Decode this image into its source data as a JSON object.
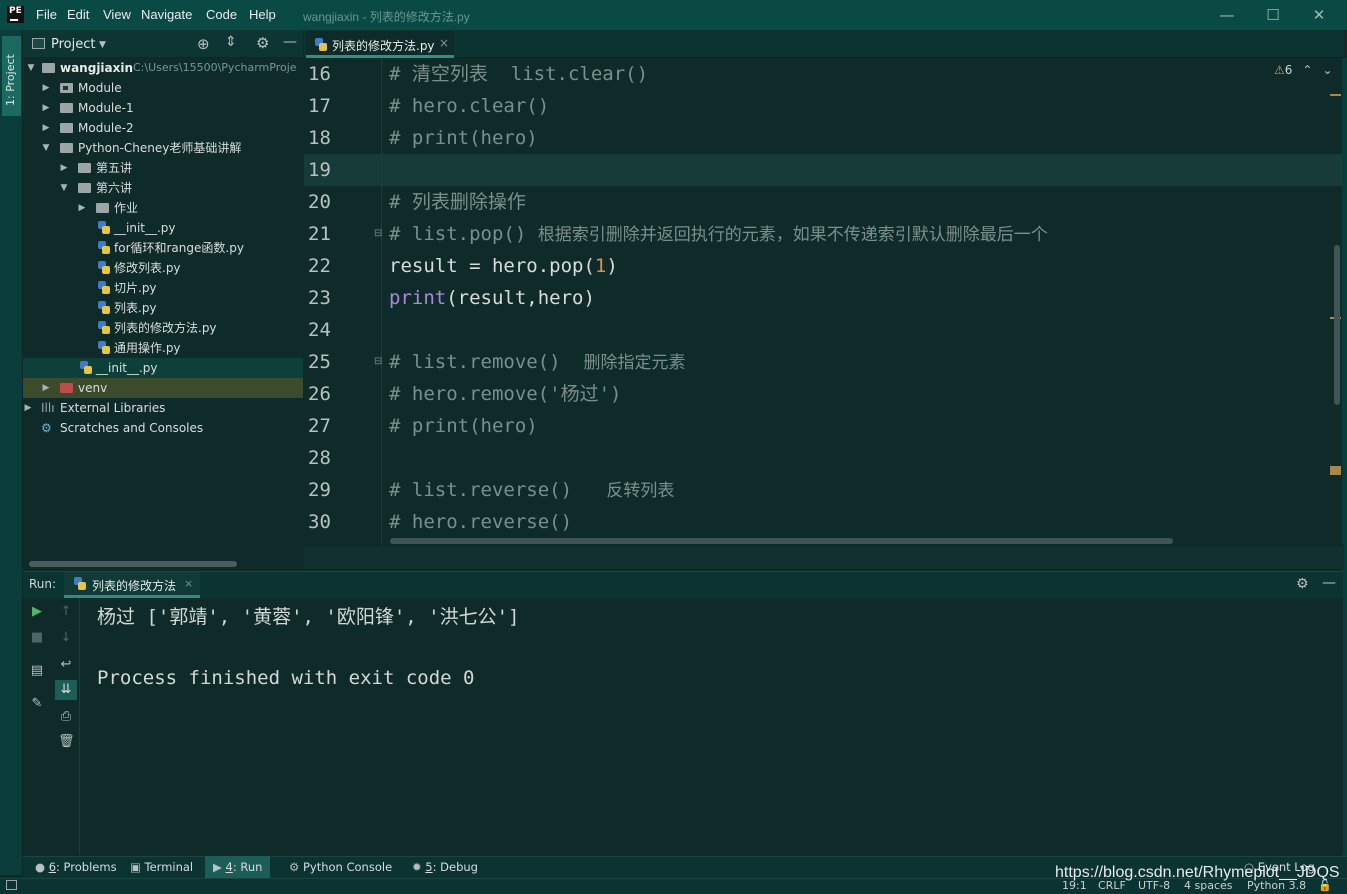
{
  "titlebar": {
    "logo": "PE",
    "menu": [
      "File",
      "Edit",
      "View",
      "Navigate",
      "Code",
      "Help"
    ],
    "title": "wangjiaxin - 列表的修改方法.py",
    "controls": {
      "minimize": "—",
      "maximize": "☐",
      "close": "✕"
    }
  },
  "left_strip": {
    "project_label": "1: Project"
  },
  "project_panel": {
    "title": "Project",
    "root_name": "wangjiaxin",
    "root_path": "C:\\Users\\15500\\PycharmProje",
    "items": [
      {
        "label": "Module",
        "type": "module"
      },
      {
        "label": "Module-1",
        "type": "folder"
      },
      {
        "label": "Module-2",
        "type": "folder"
      },
      {
        "label": "Python-Cheney老师基础讲解",
        "type": "folder"
      },
      {
        "label": "第五讲",
        "type": "folder"
      },
      {
        "label": "第六讲",
        "type": "folder"
      },
      {
        "label": "作业",
        "type": "folder"
      },
      {
        "label": "__init__.py",
        "type": "py"
      },
      {
        "label": "for循环和range函数.py",
        "type": "py"
      },
      {
        "label": "修改列表.py",
        "type": "py"
      },
      {
        "label": "切片.py",
        "type": "py"
      },
      {
        "label": "列表.py",
        "type": "py"
      },
      {
        "label": "列表的修改方法.py",
        "type": "py"
      },
      {
        "label": "通用操作.py",
        "type": "py"
      },
      {
        "label": "__init__.py",
        "type": "py"
      },
      {
        "label": "venv",
        "type": "folder-red"
      },
      {
        "label": "External Libraries",
        "type": "lib"
      },
      {
        "label": "Scratches and Consoles",
        "type": "scratch"
      }
    ]
  },
  "editor": {
    "tab_label": "列表的修改方法.py",
    "warnings": "6",
    "line_numbers": [
      "16",
      "17",
      "18",
      "19",
      "20",
      "21",
      "22",
      "23",
      "24",
      "25",
      "26",
      "27",
      "28",
      "29",
      "30"
    ],
    "lines": {
      "l16": "# 清空列表  list.clear()",
      "l17": "# hero.clear()",
      "l18": "# print(hero)",
      "l20": "# 列表删除操作",
      "l21a": "# list.pop() ",
      "l21b": "根据索引删除并返回执行的元素，如果不传递索引默认删除最后一个",
      "l22a": "result = hero.pop(",
      "l22num": "1",
      "l22b": ")",
      "l23fn": "print",
      "l23rest": "(result,hero)",
      "l25a": "# list.remove()  ",
      "l25b": "删除指定元素",
      "l26": "# hero.remove('杨过')",
      "l27": "# print(hero)",
      "l29a": "# list.reverse()   ",
      "l29b": "反转列表",
      "l30": "# hero.reverse()"
    }
  },
  "run_panel": {
    "label": "Run:",
    "tab_label": "列表的修改方法",
    "output": [
      "杨过 ['郭靖', '黄蓉', '欧阳锋', '洪七公']",
      "Process finished with exit code 0"
    ]
  },
  "bottom_tabs": {
    "problems_num": "6",
    "problems": ": Problems",
    "terminal": "Terminal",
    "run_num": "4",
    "run": ": Run",
    "python_console": "Python Console",
    "debug_num": "5",
    "debug": ": Debug",
    "event_log": "Event Log"
  },
  "status": {
    "position": "19:1",
    "line_sep": "CRLF",
    "encoding": "UTF-8",
    "indent": "4 spaces",
    "interpreter": "Python 3.8"
  },
  "watermark": "https://blog.csdn.net/Rhymeplot__JDQS"
}
